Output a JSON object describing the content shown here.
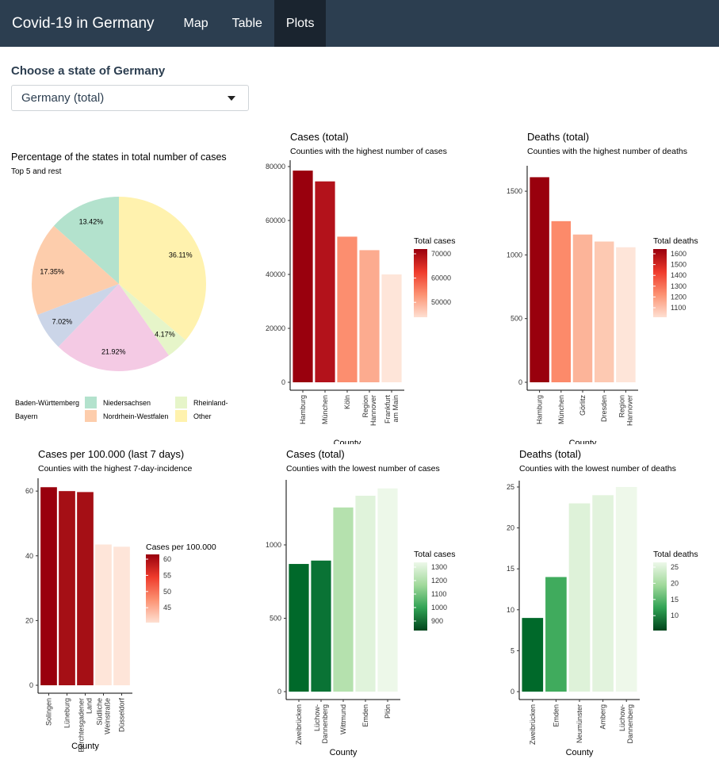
{
  "navbar": {
    "brand": "Covid-19 in Germany",
    "tabs": [
      {
        "label": "Map",
        "active": false
      },
      {
        "label": "Table",
        "active": false
      },
      {
        "label": "Plots",
        "active": true
      }
    ]
  },
  "selector": {
    "label": "Choose a state of Germany",
    "value": "Germany (total)"
  },
  "chart_data": [
    {
      "id": "pie",
      "type": "pie",
      "title": "Percentage of the states in total number of cases",
      "subtitle": "Top 5 and rest",
      "slices": [
        {
          "name": "Baden-Württemberg",
          "value": 13.42,
          "label": "13.42%",
          "color": "#b3e2cd"
        },
        {
          "name": "Bayern",
          "value": 17.35,
          "label": "17.35%",
          "color": "#fdcdac"
        },
        {
          "name": "Niedersachsen",
          "value": 7.02,
          "label": "7.02%",
          "color": "#cbd5e8"
        },
        {
          "name": "Nordrhein-Westfalen",
          "value": 21.92,
          "label": "21.92%",
          "color": "#f4cae4"
        },
        {
          "name": "Rheinland-",
          "value": 4.17,
          "label": "4.17%",
          "color": "#e6f5c9"
        },
        {
          "name": "Other",
          "value": 36.11,
          "label": "36.11%",
          "color": "#fff2ae"
        }
      ]
    },
    {
      "id": "cases-high",
      "type": "bar",
      "title": "Cases (total)",
      "subtitle": "Counties with the highest number of cases",
      "xlabel": "County",
      "ylabel": "",
      "ylim": [
        0,
        80000
      ],
      "yticks": [
        "0",
        "20000",
        "40000",
        "60000",
        "80000"
      ],
      "categories": [
        [
          "Hamburg"
        ],
        [
          "München"
        ],
        [
          "Köln"
        ],
        [
          "Region",
          "Hannover"
        ],
        [
          "Frankfurt",
          "am Main"
        ]
      ],
      "values": [
        78500,
        74500,
        54000,
        49000,
        40000
      ],
      "colors": [
        "#99000d",
        "#b3121b",
        "#fc8e6f",
        "#fcab8f",
        "#fee5d9"
      ],
      "legend": {
        "title": "Total cases",
        "ticks": [
          "70000",
          "60000",
          "50000"
        ],
        "gradient": [
          "#99000d",
          "#ef3b2c",
          "#fc9272",
          "#fee0d2"
        ]
      }
    },
    {
      "id": "deaths-high",
      "type": "bar",
      "title": "Deaths (total)",
      "subtitle": "Counties with the highest number of deaths",
      "xlabel": "County",
      "ylabel": "",
      "ylim": [
        0,
        1650
      ],
      "yticks": [
        "0",
        "500",
        "1000",
        "1500"
      ],
      "categories": [
        [
          "Hamburg"
        ],
        [
          "München"
        ],
        [
          "Görlitz"
        ],
        [
          "Dresden"
        ],
        [
          "Region",
          "Hannover"
        ]
      ],
      "values": [
        1610,
        1265,
        1160,
        1105,
        1060
      ],
      "colors": [
        "#99000d",
        "#fc8a6a",
        "#fcb499",
        "#fdc9b2",
        "#fee5d9"
      ],
      "legend": {
        "title": "Total deaths",
        "ticks": [
          "1600",
          "1500",
          "1400",
          "1300",
          "1200",
          "1100"
        ],
        "gradient": [
          "#99000d",
          "#ef3b2c",
          "#fc9272",
          "#fee0d2"
        ]
      }
    },
    {
      "id": "incidence",
      "type": "bar",
      "title": "Cases per 100.000 (last 7 days)",
      "subtitle": "Counties with the highest 7-day-incidence",
      "xlabel": "County",
      "ylabel": "",
      "ylim": [
        0,
        62
      ],
      "yticks": [
        "0",
        "20",
        "40",
        "60"
      ],
      "categories": [
        [
          "Solingen"
        ],
        [
          "Lüneburg"
        ],
        [
          "Berchtesgadener",
          "Land"
        ],
        [
          "Südliche",
          "Weinstraße"
        ],
        [
          "Düsseldorf"
        ]
      ],
      "values": [
        61.2,
        60.0,
        59.7,
        43.5,
        42.8
      ],
      "colors": [
        "#99000d",
        "#a50f15",
        "#a50f15",
        "#fee5d9",
        "#fee5d9"
      ],
      "legend": {
        "title": "Cases per 100.000",
        "ticks": [
          "60",
          "55",
          "50",
          "45"
        ],
        "gradient": [
          "#99000d",
          "#ef3b2c",
          "#fc9272",
          "#fee0d2"
        ]
      }
    },
    {
      "id": "cases-low",
      "type": "bar",
      "title": "Cases (total)",
      "subtitle": "Counties with the lowest number of cases",
      "xlabel": "County",
      "ylabel": "",
      "ylim": [
        0,
        1400
      ],
      "yticks": [
        "0",
        "500",
        "1000"
      ],
      "categories": [
        [
          "Zweibrücken"
        ],
        [
          "Lüchow-",
          "Dannenberg"
        ],
        [
          "Wittmund"
        ],
        [
          "Emden"
        ],
        [
          "Plön"
        ]
      ],
      "values": [
        870,
        893,
        1255,
        1335,
        1385
      ],
      "colors": [
        "#00692a",
        "#0a7335",
        "#b5e1ae",
        "#e0f3db",
        "#edf8e9"
      ],
      "legend": {
        "title": "Total cases",
        "ticks": [
          "1300",
          "1200",
          "1100",
          "1000",
          "900"
        ],
        "gradient": [
          "#edf8e9",
          "#a1d99b",
          "#31a354",
          "#00441b"
        ]
      }
    },
    {
      "id": "deaths-low",
      "type": "bar",
      "title": "Deaths (total)",
      "subtitle": "Counties with the lowest number of deaths",
      "xlabel": "County",
      "ylabel": "",
      "ylim": [
        0,
        25
      ],
      "yticks": [
        "0",
        "5",
        "10",
        "15",
        "20",
        "25"
      ],
      "categories": [
        [
          "Zweibrücken"
        ],
        [
          "Emden"
        ],
        [
          "Neumünster"
        ],
        [
          "Amberg"
        ],
        [
          "Lüchow-",
          "Dannenberg"
        ]
      ],
      "values": [
        9,
        14,
        23,
        24,
        25
      ],
      "colors": [
        "#00692a",
        "#40ab5d",
        "#def2d9",
        "#e2f3dd",
        "#eef8ea"
      ],
      "legend": {
        "title": "Total deaths",
        "ticks": [
          "25",
          "20",
          "15",
          "10"
        ],
        "gradient": [
          "#edf8e9",
          "#a1d99b",
          "#31a354",
          "#00441b"
        ]
      }
    }
  ]
}
